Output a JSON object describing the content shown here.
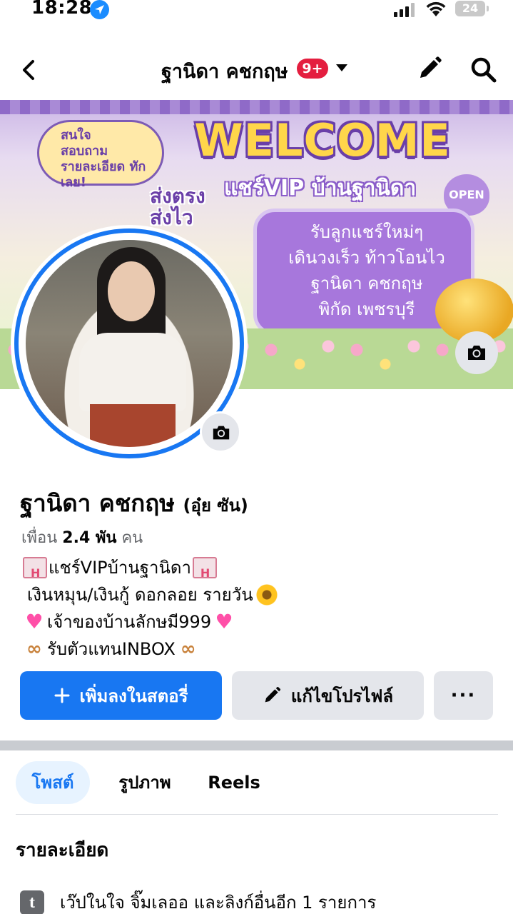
{
  "status_bar": {
    "time": "18:28",
    "battery": "24",
    "icons": [
      "location-arrow-icon",
      "cellular-signal-icon",
      "wifi-icon",
      "battery-icon"
    ]
  },
  "header": {
    "title": "ฐานิดา คชกฤษ",
    "notification_badge": "9+",
    "icons": [
      "back-chevron-icon",
      "caret-down-icon",
      "pencil-icon",
      "search-icon"
    ]
  },
  "cover": {
    "welcome": "WELCOME",
    "subtitle": "แชร์VIP บ้านฐานิดา",
    "open_badge": "OPEN",
    "bubble_text": "สนใจ\nสอบถาม\nรายละเอียด ทักเลย!",
    "side_text": "ส่งตรง\nส่งไว",
    "card_text": "รับลูกแชร์ใหม่ๆ\nเดินวงเร็ว ท้าวโอนไว\nฐานิดา คชกฤษ\nพิกัด เพชรบุรี"
  },
  "profile": {
    "name": "ฐานิดา คชกฤษ",
    "alternate_name": "(อุ๋ย ซัน)",
    "friends_prefix": "เพื่อน",
    "friends_count": "2.4 พัน",
    "friends_suffix": "คน",
    "bio": [
      "แชร์VIPบ้านฐานิดา",
      "เงินหมุน/เงินกู้ ดอกลอย รายวัน",
      "เจ้าของบ้านลักษมี999",
      "รับตัวแทนINBOX"
    ]
  },
  "actions": {
    "add_story": "เพิ่มลงในสตอรี่",
    "edit_profile": "แก้ไขโปรไฟล์",
    "more": "···"
  },
  "tabs": [
    {
      "label": "โพสต์",
      "active": true
    },
    {
      "label": "รูปภาพ",
      "active": false
    },
    {
      "label": "Reels",
      "active": false
    }
  ],
  "details": {
    "heading": "รายละเอียด",
    "items": [
      {
        "icon": "tumblr-icon",
        "icon_glyph": "t",
        "text": "เว๊ปในใจ จิ๊มเลออ และลิงก์อื่นอีก 1 รายการ"
      }
    ]
  },
  "colors": {
    "accent": "#1877f2",
    "badge": "#e41e3f",
    "button_secondary": "#e4e6eb",
    "tab_active_bg": "#e7f3ff"
  }
}
